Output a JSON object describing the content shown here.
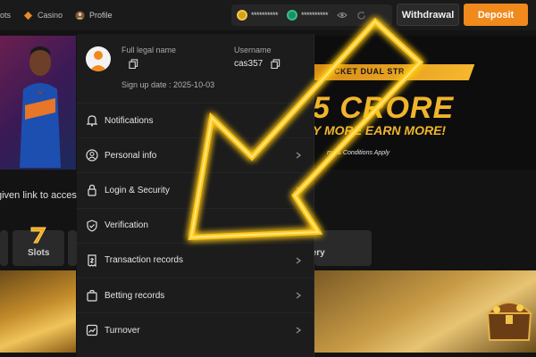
{
  "nav": {
    "items": [
      {
        "label": "lots",
        "icon": "slots-icon"
      },
      {
        "label": "Casino",
        "icon": "casino-icon"
      },
      {
        "label": "Profile",
        "icon": "avatar-icon"
      }
    ]
  },
  "balance": {
    "primary_masked": "**********",
    "secondary_masked": "**********",
    "visibility_icon": "eye-icon",
    "refresh_icon": "refresh-icon"
  },
  "actions": {
    "withdraw_label": "Withdrawal",
    "deposit_label": "Deposit"
  },
  "promo": {
    "top_text": "CKET DUAL STR",
    "big_text": "5 CRORE",
    "sub_text": "Y MORE  EARN MORE!",
    "terms": "ms & Conditions Apply"
  },
  "body_text": {
    "given_link": "given link to access"
  },
  "categories": [
    {
      "label": "Slots"
    },
    {
      "label": "ttery"
    }
  ],
  "profile": {
    "full_legal_name_label": "Full legal name",
    "username_label": "Username",
    "username": "cas357",
    "signup": "Sign up date : 2025-10-03",
    "menu": [
      {
        "label": "Notifications",
        "icon": "bell-icon"
      },
      {
        "label": "Personal info",
        "icon": "user-circle-icon"
      },
      {
        "label": "Login & Security",
        "icon": "lock-icon"
      },
      {
        "label": "Verification",
        "icon": "shield-check-icon"
      },
      {
        "label": "Transaction records",
        "icon": "receipt-icon"
      },
      {
        "label": "Betting records",
        "icon": "bag-icon"
      },
      {
        "label": "Turnover",
        "icon": "chart-icon"
      }
    ]
  },
  "colors": {
    "accent": "#f08a1c",
    "highlight": "#f6c21c",
    "panel": "#1c1c1c"
  }
}
